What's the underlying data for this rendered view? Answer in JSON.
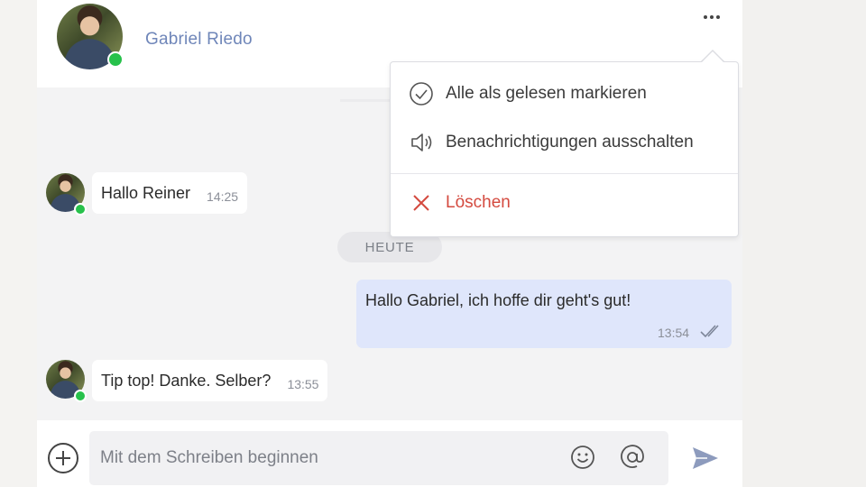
{
  "header": {
    "contact_name": "Gabriel Riedo",
    "more_icon": "more-horizontal-icon"
  },
  "menu": {
    "items": [
      {
        "label": "Alle als gelesen markieren",
        "icon": "check-circle-icon"
      },
      {
        "label": "Benachrichtigungen ausschalten",
        "icon": "speaker-icon"
      },
      {
        "label": "Löschen",
        "icon": "close-icon",
        "color": "#d44a3f"
      }
    ]
  },
  "messages": [
    {
      "direction": "in",
      "text": "Hallo Reiner",
      "time": "14:25"
    },
    {
      "direction": "day",
      "text": "HEUTE"
    },
    {
      "direction": "out",
      "text": "Hallo Gabriel, ich hoffe dir geht's gut!",
      "time": "13:54",
      "status": "read"
    },
    {
      "direction": "in",
      "text": "Tip top! Danke. Selber?",
      "time": "13:55"
    }
  ],
  "composer": {
    "placeholder": "Mit dem Schreiben beginnen",
    "value": ""
  },
  "colors": {
    "accent": "#6f86b9",
    "online": "#27c14b",
    "outgoing_bubble": "#dfe6fb",
    "danger": "#d44a3f"
  }
}
